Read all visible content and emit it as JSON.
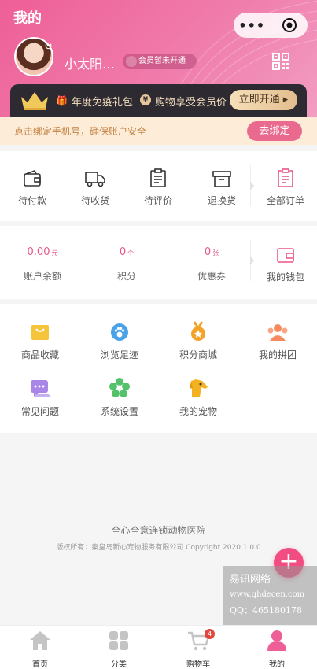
{
  "header": {
    "title": "我的",
    "capsule_more": "•••",
    "username": "小太阳…",
    "member_status": "会员暂未开通"
  },
  "vip": {
    "gift_text": "年度免疫礼包",
    "price_text": "购物享受会员价",
    "coin_symbol": "¥",
    "open_button": "立即开通 ▸"
  },
  "bind": {
    "text": "点击绑定手机号，确保账户安全",
    "button": "去绑定"
  },
  "orders": {
    "items": [
      {
        "label": "待付款",
        "icon": "wallet-icon"
      },
      {
        "label": "待收货",
        "icon": "truck-icon"
      },
      {
        "label": "待评价",
        "icon": "clipboard-icon"
      },
      {
        "label": "退换货",
        "icon": "box-icon"
      },
      {
        "label": "全部订单",
        "icon": "order-list-icon"
      }
    ]
  },
  "wallet": {
    "balance": {
      "value": "0.00",
      "unit": "元",
      "label": "账户余额"
    },
    "points": {
      "value": "0",
      "unit": "个",
      "label": "积分"
    },
    "coupons": {
      "value": "0",
      "unit": "张",
      "label": "优惠券"
    },
    "my_wallet": {
      "label": "我的钱包",
      "icon": "purse-icon"
    }
  },
  "services": {
    "items": [
      {
        "label": "商品收藏",
        "icon": "bag-icon",
        "color": "#f6c43a"
      },
      {
        "label": "浏览足迹",
        "icon": "paw-icon",
        "color": "#4aa3e8"
      },
      {
        "label": "积分商城",
        "icon": "medal-icon",
        "color": "#f3a428"
      },
      {
        "label": "我的拼团",
        "icon": "group-icon",
        "color": "#f58a5e"
      },
      {
        "label": "常见问题",
        "icon": "chat-icon",
        "color": "#a885e6"
      },
      {
        "label": "系统设置",
        "icon": "settings-flower-icon",
        "color": "#53c26a"
      },
      {
        "label": "我的宠物",
        "icon": "dog-icon",
        "color": "#f3b11f"
      }
    ]
  },
  "footer": {
    "company": "全心全意连锁动物医院",
    "copyright": "版权所有：秦皇岛新心宠物服务有限公司 Copyright 2020 1.0.0"
  },
  "fab": {
    "label": "+"
  },
  "watermark": {
    "line1": "易讯网络",
    "line2": "www.qhdecen.com",
    "line3": "QQ：465180178"
  },
  "tabbar": {
    "items": [
      {
        "label": "首页",
        "icon": "home-icon"
      },
      {
        "label": "分类",
        "icon": "category-grid-icon"
      },
      {
        "label": "购物车",
        "icon": "cart-icon",
        "badge": "4"
      },
      {
        "label": "我的",
        "icon": "user-icon",
        "active": true
      }
    ]
  },
  "colors": {
    "brand_pink": "#ee5f97",
    "price_pink": "#e8558a",
    "vip_dark": "#2d2b31",
    "vip_gold": "#e6c79c"
  }
}
